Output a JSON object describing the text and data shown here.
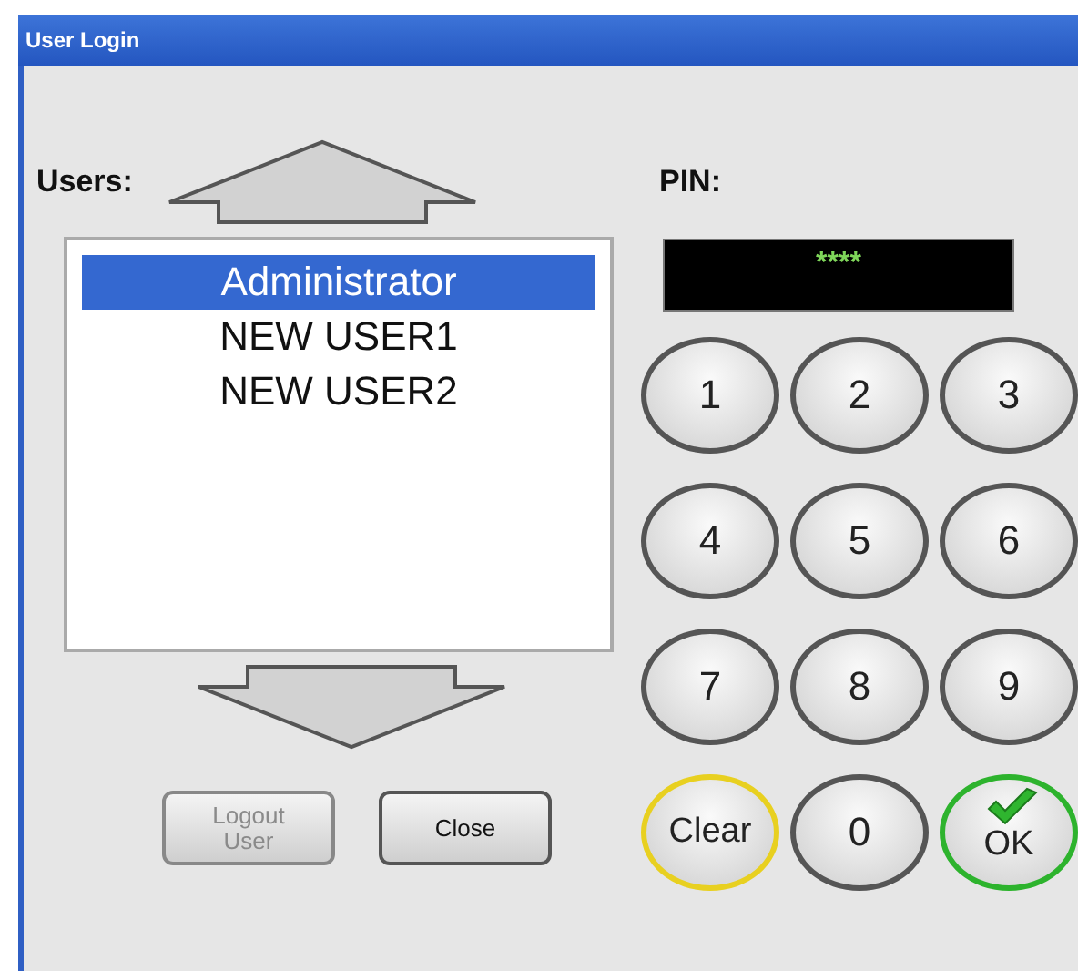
{
  "window": {
    "title": "User Login"
  },
  "users_label": "Users:",
  "users": [
    {
      "name": "Administrator",
      "selected": true
    },
    {
      "name": "NEW USER1",
      "selected": false
    },
    {
      "name": "NEW USER2",
      "selected": false
    }
  ],
  "buttons": [
    {
      "label": "Logout User",
      "disabled": true
    },
    {
      "label": "Close",
      "disabled": false
    }
  ],
  "pin_label": "PIN:",
  "pin_value": "****",
  "keys": [
    {
      "label": "1",
      "kind": "digit"
    },
    {
      "label": "2",
      "kind": "digit"
    },
    {
      "label": "3",
      "kind": "digit"
    },
    {
      "label": "4",
      "kind": "digit"
    },
    {
      "label": "5",
      "kind": "digit"
    },
    {
      "label": "6",
      "kind": "digit"
    },
    {
      "label": "7",
      "kind": "digit"
    },
    {
      "label": "8",
      "kind": "digit"
    },
    {
      "label": "9",
      "kind": "digit"
    },
    {
      "label": "Clear",
      "kind": "clear"
    },
    {
      "label": "0",
      "kind": "digit"
    },
    {
      "label": "OK",
      "kind": "ok"
    }
  ]
}
